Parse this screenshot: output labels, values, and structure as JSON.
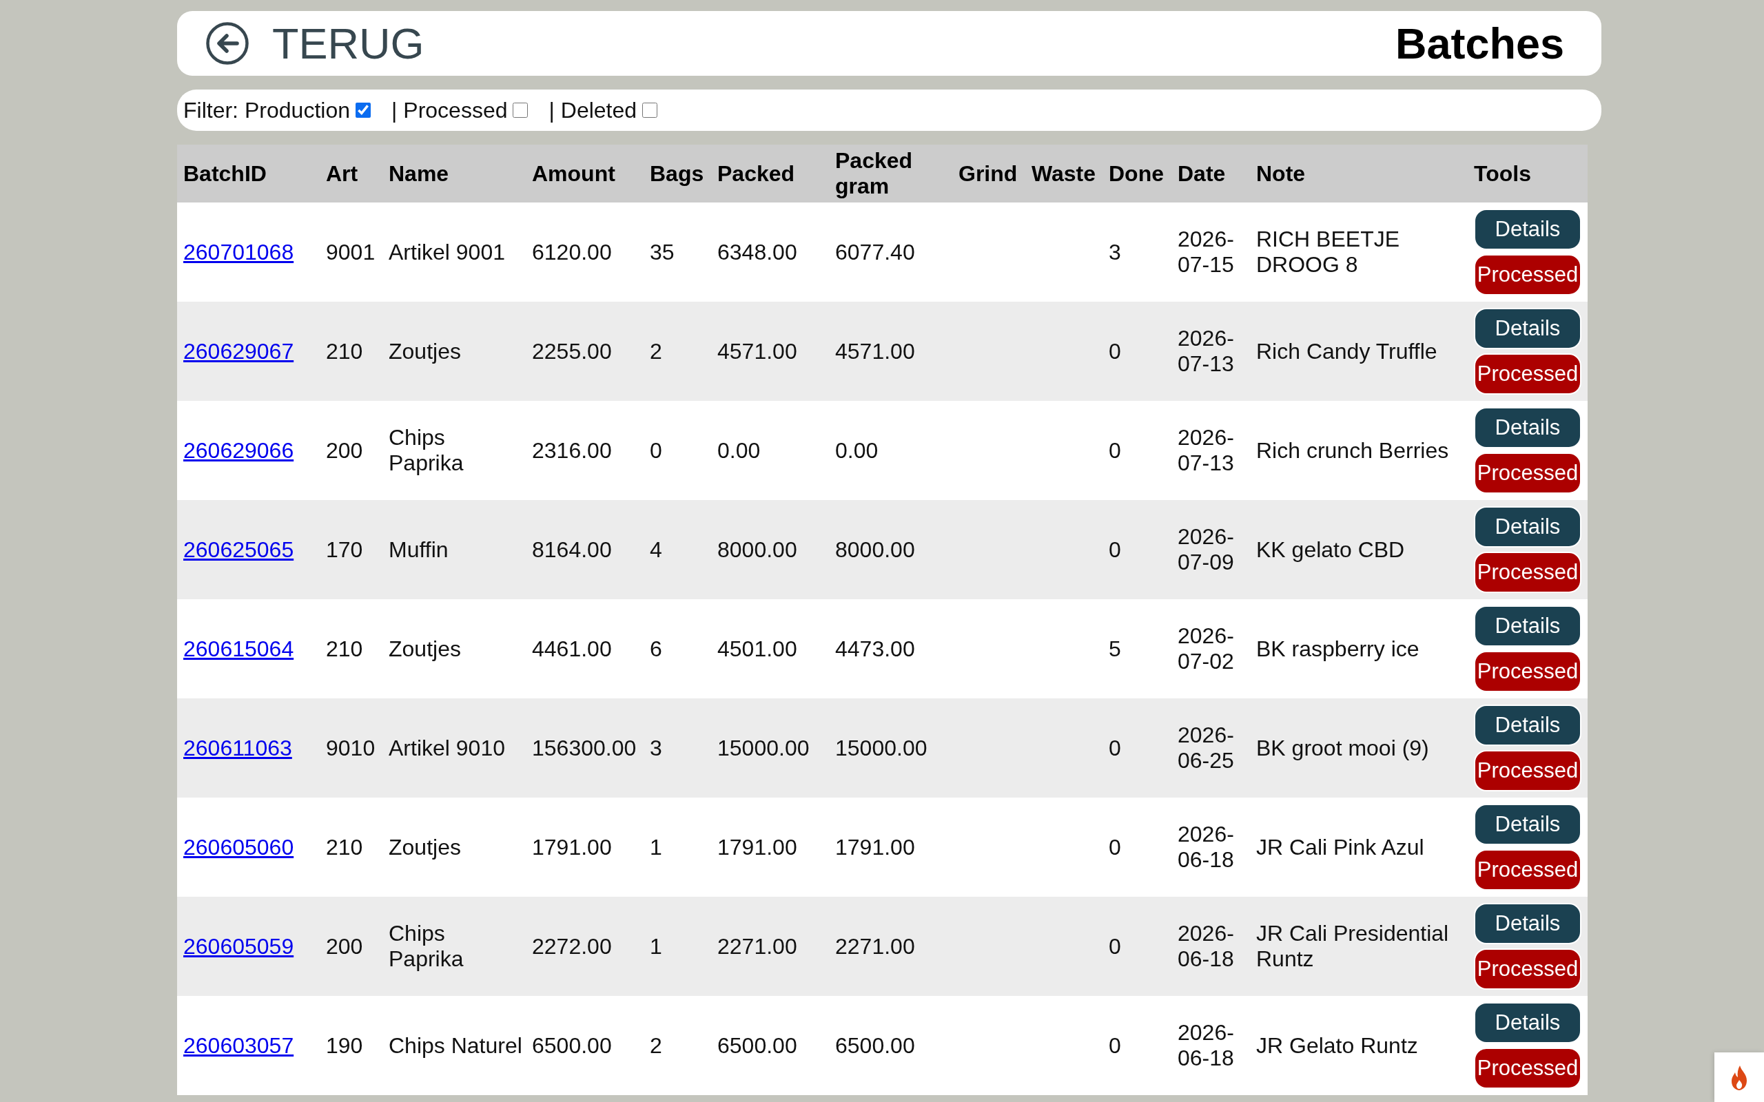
{
  "header": {
    "back_label": "TERUG",
    "title": "Batches"
  },
  "filter_bar": {
    "title": "Filter:",
    "options": [
      {
        "label": "Production",
        "checked": true
      },
      {
        "separator": "|",
        "label": "Processed",
        "checked": false
      },
      {
        "separator": "|",
        "label": "Deleted",
        "checked": false
      }
    ]
  },
  "table": {
    "columns": [
      "BatchID",
      "Art",
      "Name",
      "Amount",
      "Bags",
      "Packed",
      "Packed gram",
      "Grind",
      "Waste",
      "Done",
      "Date",
      "Note",
      "Tools"
    ],
    "rows": [
      {
        "batch_id": "260701068",
        "art": "9001",
        "name": "Artikel 9001",
        "amount": "6120.00",
        "bags": "35",
        "packed": "6348.00",
        "packed_gram": "6077.40",
        "done": "3",
        "date": "2026-07-15",
        "note": "RICH BEETJE DROOG 8",
        "actions": [
          {
            "kind": "details",
            "label": "Details"
          },
          {
            "kind": "processed",
            "label": "Processed"
          }
        ]
      },
      {
        "batch_id": "260629067",
        "art": "210",
        "name": "Zoutjes",
        "amount": "2255.00",
        "bags": "2",
        "packed": "4571.00",
        "packed_gram": "4571.00",
        "done": "0",
        "date": "2026-07-13",
        "note": "Rich Candy Truffle",
        "actions": [
          {
            "kind": "details",
            "label": "Details"
          },
          {
            "kind": "processed",
            "label": "Processed"
          }
        ]
      },
      {
        "batch_id": "260629066",
        "art": "200",
        "name": "Chips Paprika",
        "amount": "2316.00",
        "bags": "0",
        "packed": "0.00",
        "packed_gram": "0.00",
        "done": "0",
        "date": "2026-07-13",
        "note": "Rich crunch Berries",
        "actions": [
          {
            "kind": "details",
            "label": "Details"
          },
          {
            "kind": "processed",
            "label": "Processed"
          }
        ]
      },
      {
        "batch_id": "260625065",
        "art": "170",
        "name": "Muffin",
        "amount": "8164.00",
        "bags": "4",
        "packed": "8000.00",
        "packed_gram": "8000.00",
        "done": "0",
        "date": "2026-07-09",
        "note": "KK gelato CBD",
        "actions": [
          {
            "kind": "details",
            "label": "Details"
          },
          {
            "kind": "processed",
            "label": "Processed"
          }
        ]
      },
      {
        "batch_id": "260615064",
        "art": "210",
        "name": "Zoutjes",
        "amount": "4461.00",
        "bags": "6",
        "packed": "4501.00",
        "packed_gram": "4473.00",
        "done": "5",
        "date": "2026-07-02",
        "note": "BK raspberry ice",
        "actions": [
          {
            "kind": "details",
            "label": "Details"
          },
          {
            "kind": "processed",
            "label": "Processed"
          }
        ]
      },
      {
        "batch_id": "260611063",
        "art": "9010",
        "name": "Artikel 9010",
        "amount": "156300.00",
        "bags": "3",
        "packed": "15000.00",
        "packed_gram": "15000.00",
        "done": "0",
        "date": "2026-06-25",
        "note": "BK groot mooi (9)",
        "actions": [
          {
            "kind": "details",
            "label": "Details"
          },
          {
            "kind": "processed",
            "label": "Processed"
          }
        ]
      },
      {
        "batch_id": "260605060",
        "art": "210",
        "name": "Zoutjes",
        "amount": "1791.00",
        "bags": "1",
        "packed": "1791.00",
        "packed_gram": "1791.00",
        "done": "0",
        "date": "2026-06-18",
        "note": "JR Cali Pink Azul",
        "actions": [
          {
            "kind": "details",
            "label": "Details"
          },
          {
            "kind": "processed",
            "label": "Processed"
          }
        ]
      },
      {
        "batch_id": "260605059",
        "art": "200",
        "name": "Chips Paprika",
        "amount": "2272.00",
        "bags": "1",
        "packed": "2271.00",
        "packed_gram": "2271.00",
        "done": "0",
        "date": "2026-06-18",
        "note": "JR Cali Presidential Runtz",
        "actions": [
          {
            "kind": "details",
            "label": "Details"
          },
          {
            "kind": "processed",
            "label": "Processed"
          }
        ]
      },
      {
        "batch_id": "260603057",
        "art": "190",
        "name": "Chips Naturel",
        "amount": "6500.00",
        "bags": "2",
        "packed": "6500.00",
        "packed_gram": "6500.00",
        "done": "0",
        "date": "2026-06-18",
        "note": "JR Gelato Runtz",
        "actions": [
          {
            "kind": "details",
            "label": "Details"
          },
          {
            "kind": "processed",
            "label": "Processed"
          }
        ]
      }
    ]
  }
}
